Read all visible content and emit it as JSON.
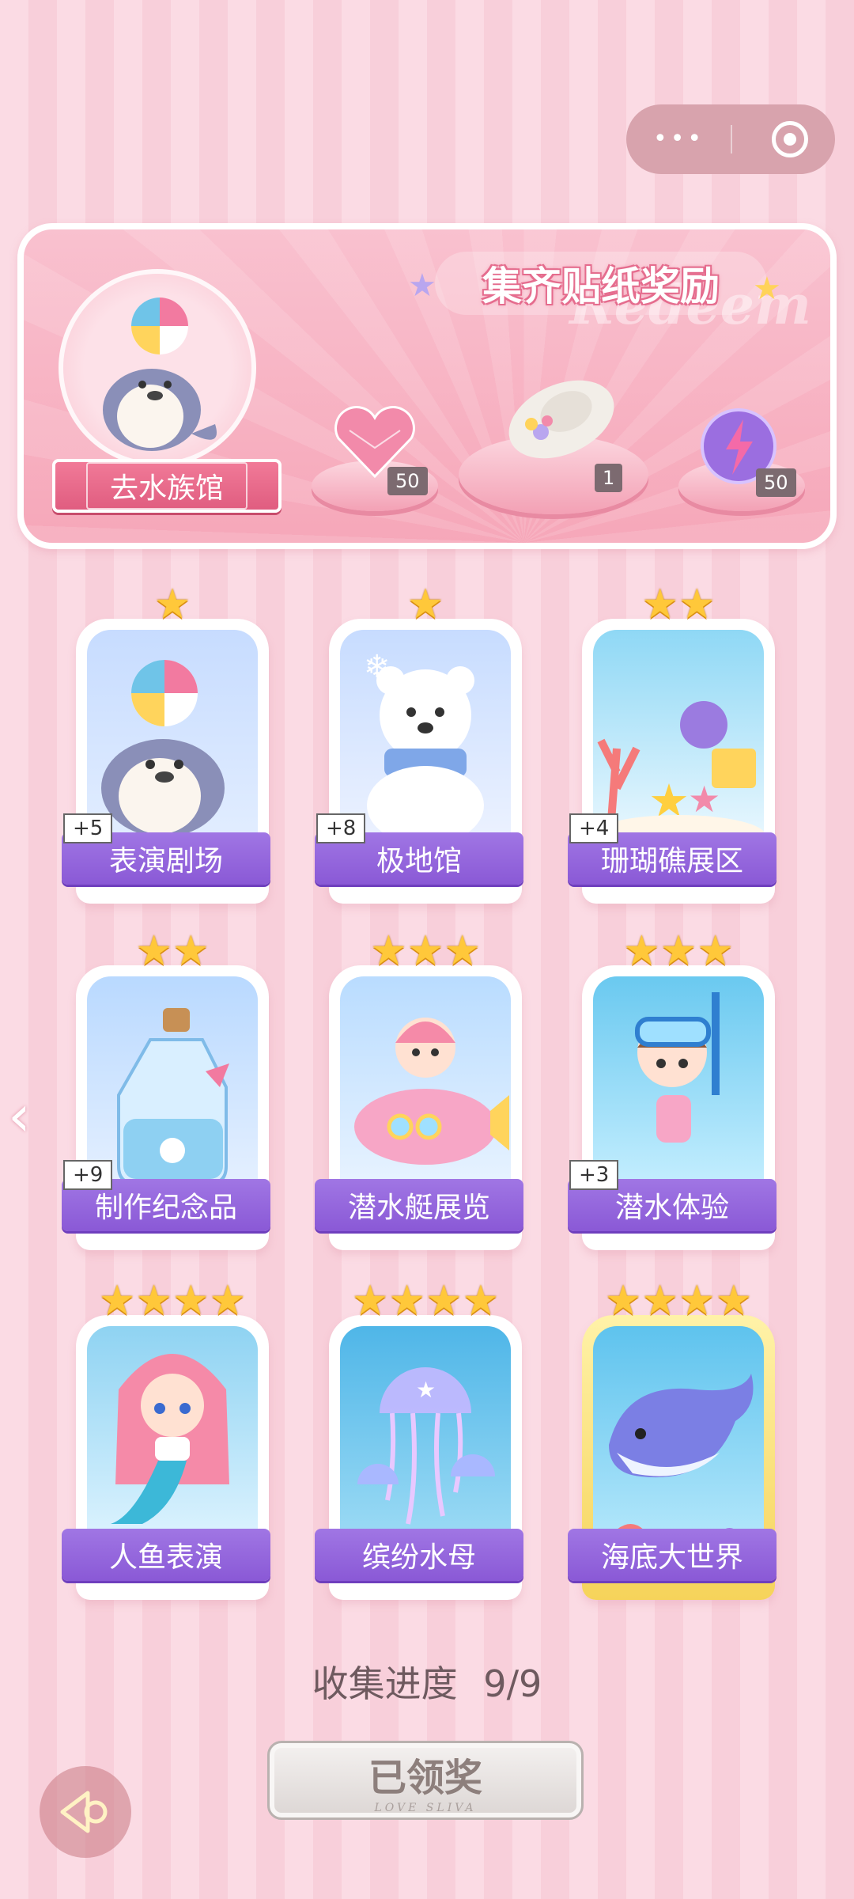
{
  "capsule": {
    "more_glyph": "•••",
    "icons": [
      "more-icon",
      "close-target-icon"
    ]
  },
  "banner": {
    "title": "集齐贴纸奖励",
    "watermark": "Redeem",
    "aquarium_button": "去水族馆",
    "rewards": [
      {
        "item": "pink-heart-gem",
        "count": "50"
      },
      {
        "item": "lace-hat",
        "count": "1"
      },
      {
        "item": "lightning-orb",
        "count": "50"
      }
    ]
  },
  "cards": [
    {
      "label": "表演剧场",
      "stars": 1,
      "bonus": "+5",
      "art": "seal-with-ball"
    },
    {
      "label": "极地馆",
      "stars": 1,
      "bonus": "+8",
      "art": "polar-bear"
    },
    {
      "label": "珊瑚礁展区",
      "stars": 2,
      "bonus": "+4",
      "art": "coral-reef"
    },
    {
      "label": "制作纪念品",
      "stars": 2,
      "bonus": "+9",
      "art": "souvenir-bottle"
    },
    {
      "label": "潜水艇展览",
      "stars": 3,
      "bonus": "",
      "art": "submarine-girl"
    },
    {
      "label": "潜水体验",
      "stars": 3,
      "bonus": "+3",
      "art": "diver-girl"
    },
    {
      "label": "人鱼表演",
      "stars": 4,
      "bonus": "",
      "art": "mermaid"
    },
    {
      "label": "缤纷水母",
      "stars": 4,
      "bonus": "",
      "art": "jellyfish"
    },
    {
      "label": "海底大世界",
      "stars": 4,
      "bonus": "",
      "art": "whale",
      "gold": true
    }
  ],
  "progress": {
    "label": "收集进度",
    "value": "9/9"
  },
  "claim": {
    "label": "已领奖",
    "sub": "LOVE SLIVA"
  },
  "colors": {
    "accent_purple": "#8a59d6",
    "accent_pink": "#e05d80",
    "star_gold": "#ffc83a"
  }
}
